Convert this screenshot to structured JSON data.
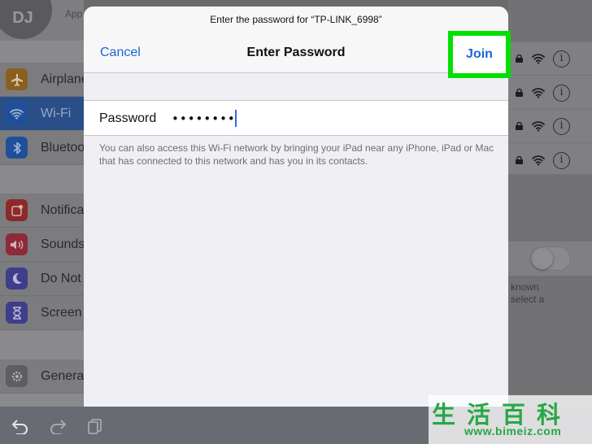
{
  "profile": {
    "initials": "DJ",
    "subtitle": "App"
  },
  "sidebar": {
    "group1": [
      {
        "label": "Airplane",
        "icon": "airplane-icon",
        "color": "#8a5f20"
      },
      {
        "label": "Wi-Fi",
        "icon": "wifi-icon",
        "color": "#1f4f9a",
        "active": true
      },
      {
        "label": "Bluetooth",
        "icon": "bluetooth-icon",
        "color": "#1f4f9a"
      }
    ],
    "group2": [
      {
        "label": "Notifications",
        "icon": "notifications-icon",
        "color": "#8c2a2a"
      },
      {
        "label": "Sounds",
        "icon": "speaker-icon",
        "color": "#8c2a3a"
      },
      {
        "label": "Do Not Disturb",
        "icon": "moon-icon",
        "color": "#3e3e8c"
      },
      {
        "label": "Screen Time",
        "icon": "hourglass-icon",
        "color": "#3e3e8c"
      }
    ],
    "group3": [
      {
        "label": "General",
        "icon": "gear-icon",
        "color": "#5e5e61"
      }
    ]
  },
  "networks": {
    "info_glyph": "i",
    "rows": [
      {},
      {},
      {},
      {}
    ]
  },
  "ask_to_join": {
    "hint": "known\nselect a"
  },
  "modal": {
    "subtitle": "Enter the password for “TP-LINK_6998”",
    "title": "Enter Password",
    "cancel_label": "Cancel",
    "join_label": "Join",
    "password_label": "Password",
    "password_value": "••••••••",
    "note": "You can also access this Wi-Fi network by bringing your iPad near any iPhone, iPad or Mac that has connected to this network and has you in its contacts."
  },
  "colors": {
    "accent": "#1a66d6",
    "highlight": "#00e000",
    "watermark": "#28a745"
  },
  "toolbar": {
    "icons": [
      "undo-icon",
      "redo-icon",
      "paste-icon"
    ]
  },
  "watermark": {
    "logo_text": "生活百科",
    "url": "www.bimeiz.com"
  }
}
